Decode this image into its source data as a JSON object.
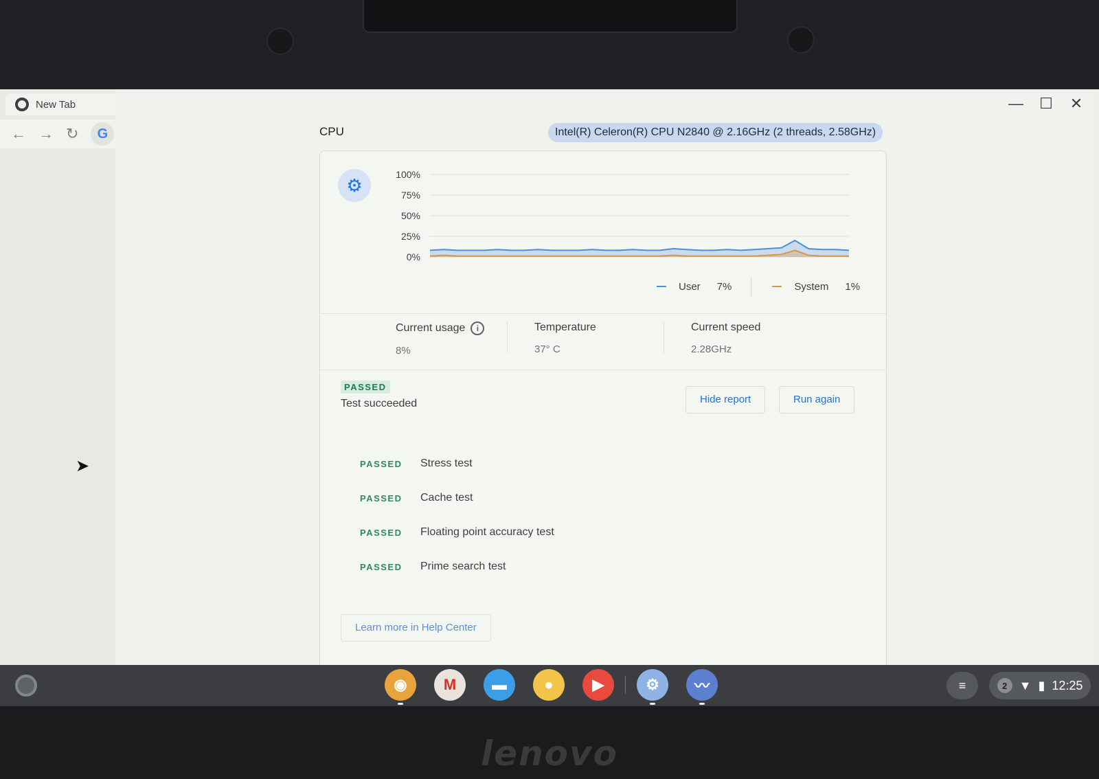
{
  "brand": "lenovo",
  "browser": {
    "tab_title": "New Tab",
    "back_icon": "←",
    "forward_icon": "→",
    "reload_icon": "↻",
    "google_button": "G"
  },
  "window": {
    "minimize": "—",
    "maximize": "☐",
    "close": "✕"
  },
  "cpu": {
    "title": "CPU",
    "model": "Intel(R) Celeron(R) CPU N2840 @ 2.16GHz (2 threads, 2.58GHz)"
  },
  "chart_data": {
    "type": "area",
    "y_ticks": [
      "100%",
      "75%",
      "50%",
      "25%",
      "0%"
    ],
    "ylim": [
      0,
      100
    ],
    "grid": true,
    "legend_placement": "bottom-right",
    "series": [
      {
        "name": "User",
        "color": "#4a8fdc",
        "values": [
          8,
          9,
          8,
          8,
          8,
          9,
          8,
          8,
          9,
          8,
          8,
          8,
          9,
          8,
          8,
          9,
          8,
          8,
          10,
          9,
          8,
          8,
          9,
          8,
          9,
          10,
          11,
          20,
          10,
          9,
          9,
          8
        ]
      },
      {
        "name": "System",
        "color": "#d9954a",
        "values": [
          1,
          2,
          1,
          1,
          1,
          1,
          1,
          1,
          1,
          1,
          1,
          1,
          1,
          1,
          1,
          1,
          1,
          1,
          2,
          1,
          1,
          1,
          1,
          1,
          1,
          2,
          3,
          8,
          2,
          1,
          1,
          1
        ]
      }
    ]
  },
  "legend": {
    "user_label": "User",
    "user_value": "7%",
    "system_label": "System",
    "system_value": "1%"
  },
  "stats": {
    "usage_label": "Current usage",
    "usage_value": "8%",
    "temp_label": "Temperature",
    "temp_value": "37° C",
    "speed_label": "Current speed",
    "speed_value": "2.28GHz"
  },
  "result": {
    "status": "PASSED",
    "message": "Test succeeded",
    "hide_report": "Hide report",
    "run_again": "Run again"
  },
  "routines": [
    {
      "status": "PASSED",
      "name": "Stress test"
    },
    {
      "status": "PASSED",
      "name": "Cache test"
    },
    {
      "status": "PASSED",
      "name": "Floating point accuracy test"
    },
    {
      "status": "PASSED",
      "name": "Prime search test"
    }
  ],
  "help_link": "Learn more in Help Center",
  "shelf": {
    "apps": [
      {
        "name": "chrome",
        "glyph": "◉",
        "color": "#e8a33d",
        "active": true
      },
      {
        "name": "gmail",
        "glyph": "M",
        "color": "#e8e3dc",
        "active": false
      },
      {
        "name": "files",
        "glyph": "▬",
        "color": "#3d9ee8",
        "active": false
      },
      {
        "name": "camera",
        "glyph": "●",
        "color": "#f2c54a",
        "active": false
      },
      {
        "name": "youtube",
        "glyph": "▶",
        "color": "#e84a3d",
        "active": false
      },
      {
        "name": "settings",
        "glyph": "⚙",
        "color": "#8fb3e6",
        "active": true
      },
      {
        "name": "diagnostics",
        "glyph": "〰",
        "color": "#5c7fcf",
        "active": true
      }
    ],
    "notifications_count": "2",
    "time": "12:25"
  }
}
